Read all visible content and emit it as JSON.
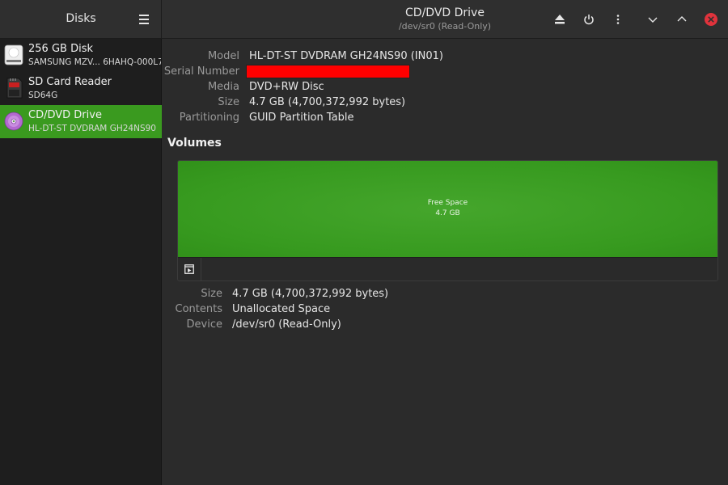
{
  "header": {
    "left_title": "Disks",
    "title": "CD/DVD Drive",
    "subtitle": "/dev/sr0 (Read-Only)"
  },
  "sidebar": {
    "items": [
      {
        "name": "256 GB Disk",
        "sub": "SAMSUNG MZV... 6HAHQ-000L7",
        "icon": "hard-disk-icon",
        "selected": false
      },
      {
        "name": "SD Card Reader",
        "sub": "SD64G",
        "icon": "sd-card-icon",
        "selected": false
      },
      {
        "name": "CD/DVD Drive",
        "sub": "HL-DT-ST DVDRAM GH24NS90",
        "icon": "optical-disc-icon",
        "selected": true
      }
    ]
  },
  "drive": {
    "model_label": "Model",
    "model_value": "HL-DT-ST DVDRAM GH24NS90 (IN01)",
    "serial_label": "Serial Number",
    "media_label": "Media",
    "media_value": "DVD+RW Disc",
    "size_label": "Size",
    "size_value": "4.7 GB (4,700,372,992 bytes)",
    "partitioning_label": "Partitioning",
    "partitioning_value": "GUID Partition Table"
  },
  "volumes": {
    "title": "Volumes",
    "segment_name": "Free Space",
    "segment_size": "4.7 GB",
    "size_label": "Size",
    "size_value": "4.7 GB (4,700,372,992 bytes)",
    "contents_label": "Contents",
    "contents_value": "Unallocated Space",
    "device_label": "Device",
    "device_value": "/dev/sr0 (Read-Only)"
  },
  "colors": {
    "accent": "#3a9a1f",
    "close": "#e0333c",
    "redaction": "#ff0000"
  }
}
